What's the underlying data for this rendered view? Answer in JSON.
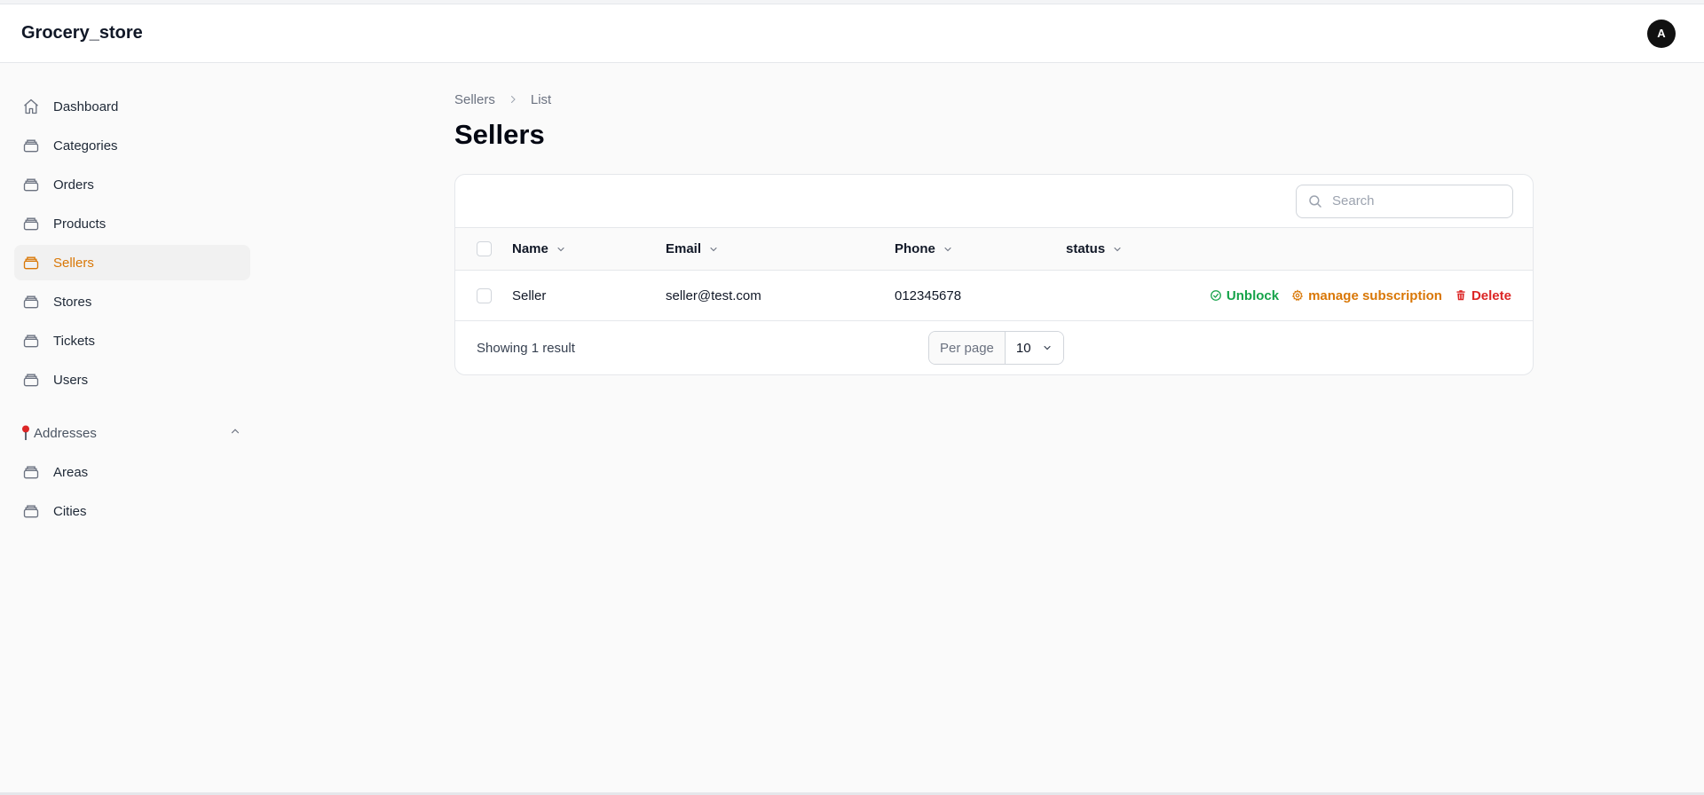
{
  "app": {
    "brand": "Grocery_store",
    "avatar_initial": "A"
  },
  "sidebar": {
    "items": [
      {
        "label": "Dashboard",
        "icon": "home-icon"
      },
      {
        "label": "Categories",
        "icon": "stack-icon"
      },
      {
        "label": "Orders",
        "icon": "stack-icon"
      },
      {
        "label": "Products",
        "icon": "stack-icon"
      },
      {
        "label": "Sellers",
        "icon": "stack-icon",
        "active": true
      },
      {
        "label": "Stores",
        "icon": "stack-icon"
      },
      {
        "label": "Tickets",
        "icon": "stack-icon"
      },
      {
        "label": "Users",
        "icon": "stack-icon"
      }
    ],
    "group": {
      "label": "Addresses",
      "icon": "pushpin-icon",
      "expanded": true,
      "items": [
        {
          "label": "Areas",
          "icon": "stack-icon"
        },
        {
          "label": "Cities",
          "icon": "stack-icon"
        }
      ]
    }
  },
  "breadcrumb": {
    "items": [
      "Sellers",
      "List"
    ]
  },
  "page": {
    "title": "Sellers"
  },
  "search": {
    "placeholder": "Search",
    "value": ""
  },
  "table": {
    "columns": [
      "Name",
      "Email",
      "Phone",
      "status"
    ],
    "rows": [
      {
        "name": "Seller",
        "email": "seller@test.com",
        "phone": "012345678",
        "status": ""
      }
    ],
    "actions": {
      "unblock": "Unblock",
      "manage": "manage subscription",
      "delete": "Delete"
    }
  },
  "pagination": {
    "showing": "Showing 1 result",
    "per_page_label": "Per page",
    "per_page_value": "10"
  },
  "colors": {
    "accent": "#d97706",
    "success": "#16a34a",
    "danger": "#dc2626"
  }
}
